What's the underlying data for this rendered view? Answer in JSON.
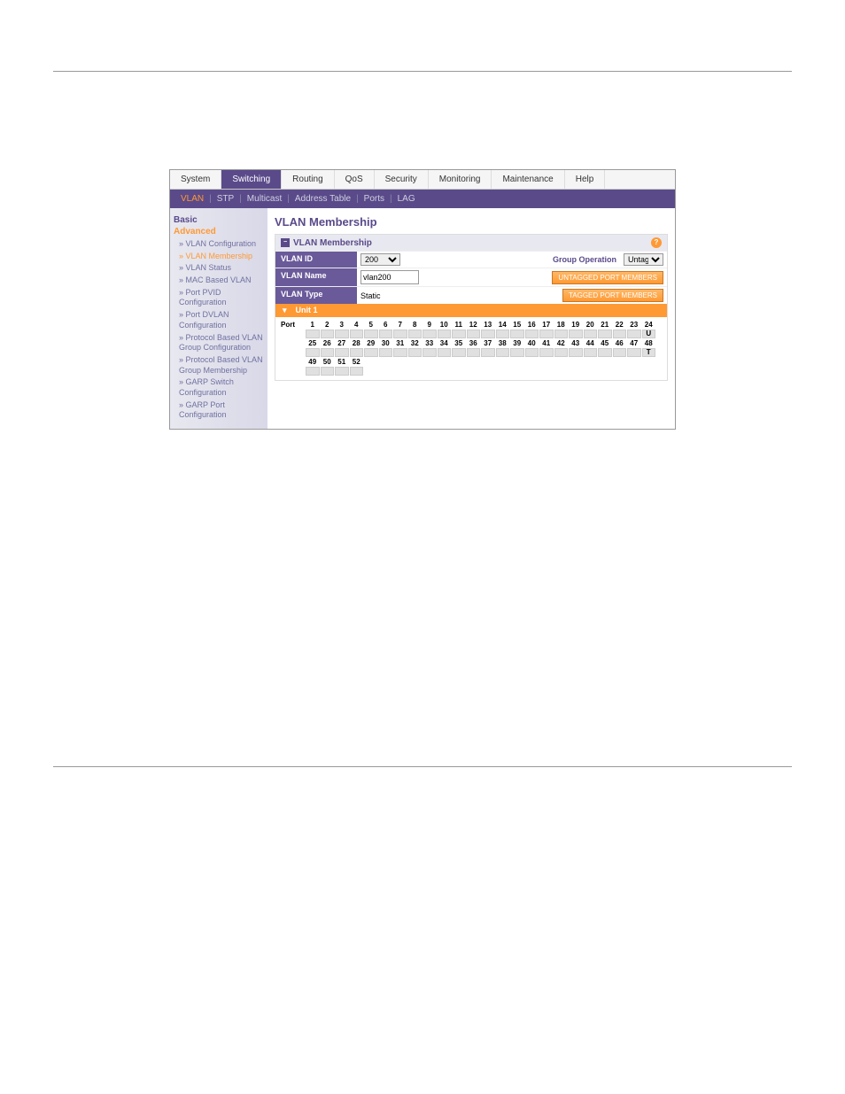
{
  "topTabs": [
    "System",
    "Switching",
    "Routing",
    "QoS",
    "Security",
    "Monitoring",
    "Maintenance",
    "Help"
  ],
  "topTabActive": "Switching",
  "subTabs": [
    "VLAN",
    "STP",
    "Multicast",
    "Address Table",
    "Ports",
    "LAG"
  ],
  "subTabActive": "VLAN",
  "sidebar": {
    "basic": "Basic",
    "advanced": "Advanced",
    "items": [
      "VLAN Configuration",
      "VLAN Membership",
      "VLAN Status",
      "MAC Based VLAN",
      "Port PVID Configuration",
      "Port DVLAN Configuration",
      "Protocol Based VLAN Group Configuration",
      "Protocol Based VLAN Group Membership",
      "GARP Switch Configuration",
      "GARP Port Configuration"
    ],
    "activeItem": "VLAN Membership"
  },
  "panel": {
    "title": "VLAN Membership",
    "header": "VLAN Membership",
    "vlanIdLabel": "VLAN ID",
    "vlanIdValue": "200",
    "vlanNameLabel": "VLAN Name",
    "vlanNameValue": "vlan200",
    "vlanTypeLabel": "VLAN Type",
    "vlanTypeValue": "Static",
    "groupOpLabel": "Group Operation",
    "groupOpValue": "Untag All",
    "untaggedBtn": "UNTAGGED PORT MEMBERS",
    "taggedBtn": "TAGGED PORT MEMBERS",
    "unitLabel": "Unit 1",
    "portLabel": "Port",
    "portRows": [
      {
        "nums": [
          "1",
          "2",
          "3",
          "4",
          "5",
          "6",
          "7",
          "8",
          "9",
          "10",
          "11",
          "12",
          "13",
          "14",
          "15",
          "16",
          "17",
          "18",
          "19",
          "20",
          "21",
          "22",
          "23",
          "24"
        ],
        "end": "U"
      },
      {
        "nums": [
          "25",
          "26",
          "27",
          "28",
          "29",
          "30",
          "31",
          "32",
          "33",
          "34",
          "35",
          "36",
          "37",
          "38",
          "39",
          "40",
          "41",
          "42",
          "43",
          "44",
          "45",
          "46",
          "47",
          "48"
        ],
        "end": "T"
      },
      {
        "nums": [
          "49",
          "50",
          "51",
          "52"
        ],
        "end": ""
      }
    ]
  }
}
